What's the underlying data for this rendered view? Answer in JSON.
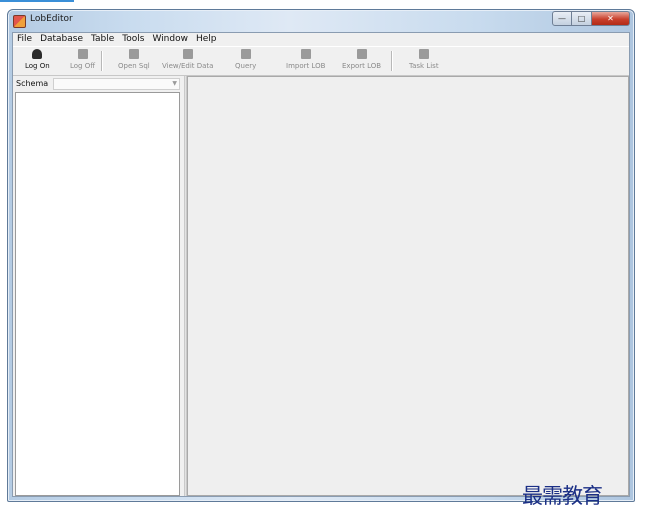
{
  "window": {
    "title": "LobEditor"
  },
  "menu": [
    "File",
    "Database",
    "Table",
    "Tools",
    "Window",
    "Help"
  ],
  "toolbar": {
    "log_on": "Log On",
    "log_off": "Log Off",
    "open_sql": "Open Sql",
    "view_edit": "View/Edit Data",
    "query": "Query",
    "import_lob": "Import LOB",
    "export_lob": "Export LOB",
    "task_list": "Task List"
  },
  "schema": {
    "label": "Schema",
    "value": ""
  },
  "watermark": "最需教育"
}
